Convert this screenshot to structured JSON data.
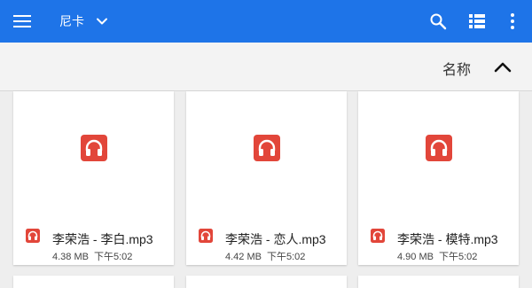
{
  "appbar": {
    "title": "尼卡",
    "color": "#1e74e8",
    "icons": [
      "menu-icon",
      "chevron-down-icon",
      "search-icon",
      "list-view-icon",
      "more-vert-icon"
    ]
  },
  "sortbar": {
    "label": "名称",
    "direction_icon": "chevron-up-icon"
  },
  "files": [
    {
      "name": "李荣浩 - 李白.mp3",
      "size": "4.38 MB",
      "time": "下午5:02",
      "icon": "headphones-icon"
    },
    {
      "name": "李荣浩 - 恋人.mp3",
      "size": "4.42 MB",
      "time": "下午5:02",
      "icon": "headphones-icon"
    },
    {
      "name": "李荣浩 - 模特.mp3",
      "size": "4.90 MB",
      "time": "下午5:02",
      "icon": "headphones-icon"
    }
  ],
  "audio_icon_color": "#e2463a"
}
